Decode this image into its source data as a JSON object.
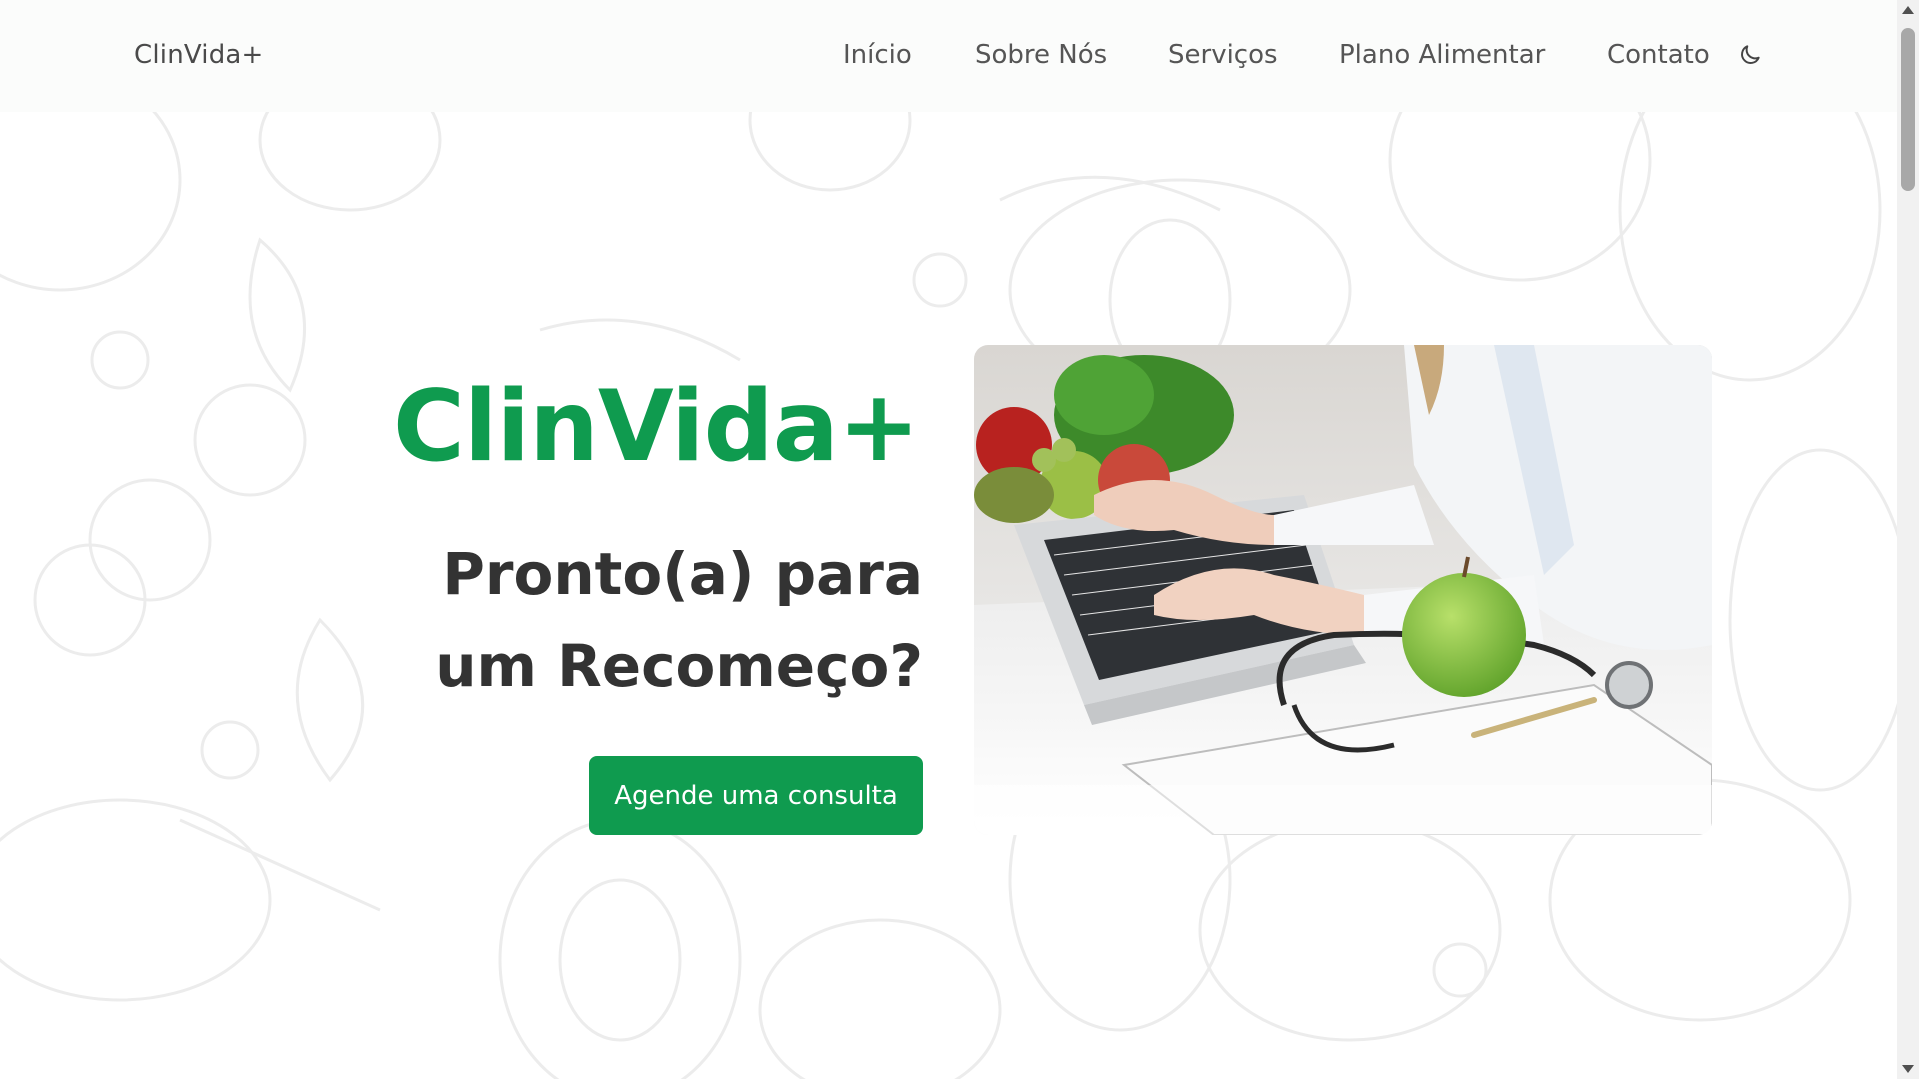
{
  "navbar": {
    "brand": "ClinVida+",
    "links": [
      {
        "label": "Início"
      },
      {
        "label": "Sobre Nós"
      },
      {
        "label": "Serviços"
      },
      {
        "label": "Plano Alimentar"
      },
      {
        "label": "Contato"
      }
    ],
    "theme_icon": "moon-icon"
  },
  "hero": {
    "title": "ClinVida+",
    "subtitle": "Pronto(a) para um Recomeço?",
    "cta_label": "Agende uma consulta",
    "image_icon": "nutritionist-laptop-photo"
  },
  "colors": {
    "accent": "#0f9b4f",
    "heading": "#333333",
    "nav_text": "#555555"
  }
}
